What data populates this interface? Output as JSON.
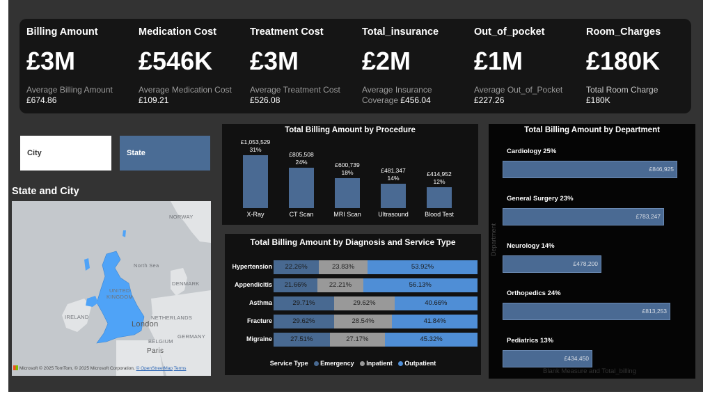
{
  "kpis": [
    {
      "title": "Billing Amount",
      "value": "£3M",
      "sub_label": "Average Billing Amount",
      "sub_label2": "",
      "sub_value": "£674.86"
    },
    {
      "title": "Medication Cost",
      "value": "£546K",
      "sub_label": "Average Medication Cost",
      "sub_label2": "",
      "sub_value": "£109.21"
    },
    {
      "title": "Treatment Cost",
      "value": "£3M",
      "sub_label": "Average Treatment Cost",
      "sub_label2": "",
      "sub_value": "£526.08"
    },
    {
      "title": "Total_insurance",
      "value": "£2M",
      "sub_label": "Average Insurance",
      "sub_label2": "Coverage",
      "sub_value": "£456.04"
    },
    {
      "title": "Out_of_pocket",
      "value": "£1M",
      "sub_label": "Average Out_of_Pocket",
      "sub_label2": "",
      "sub_value": "£227.26"
    },
    {
      "title": "Room_Charges",
      "value": "£180K",
      "sub_label": "Total Room Charge",
      "sub_label2": "",
      "sub_value": "£180K"
    }
  ],
  "slicers": {
    "city": "City",
    "state": "State"
  },
  "map": {
    "title": "State and City",
    "labels": {
      "norway": "NORWAY",
      "north_sea": "North Sea",
      "denmark": "DENMARK",
      "united": "UNITED",
      "kingdom": "KINGDOM",
      "ireland": "IRELAND",
      "netherlands": "NETHERLANDS",
      "london": "London",
      "germany": "GERMANY",
      "belgium": "BELGIUM",
      "paris": "Paris"
    },
    "attribution": {
      "brand": "Microsoft",
      "text": "© 2025 TomTom, © 2025 Microsoft Corporation,",
      "osm": "© OpenStreetMap",
      "terms": "Terms"
    },
    "colors": {
      "land": "#c4c8cc",
      "highlight": "#4fa3f7"
    }
  },
  "procedure_chart": {
    "title": "Total Billing Amount by Procedure",
    "chart_data": {
      "type": "bar",
      "categories": [
        "X-Ray",
        "CT Scan",
        "MRI Scan",
        "Ultrasound",
        "Blood Test"
      ],
      "values": [
        1053529,
        805508,
        600739,
        481347,
        414952
      ],
      "value_labels": [
        "£1,053,529",
        "£805,508",
        "£600,739",
        "£481,347",
        "£414,952"
      ],
      "pct_labels": [
        "31%",
        "24%",
        "18%",
        "14%",
        "12%"
      ],
      "ylim": [
        0,
        1053529
      ],
      "color": "#4a6a93"
    }
  },
  "diagnosis_chart": {
    "title": "Total Billing Amount by Diagnosis and Service Type",
    "chart_data": {
      "type": "bar",
      "stacked": "100%",
      "categories": [
        "Hypertension",
        "Appendicitis",
        "Asthma",
        "Fracture",
        "Migraine"
      ],
      "series": [
        {
          "name": "Emergency",
          "values": [
            22.26,
            21.66,
            29.71,
            29.62,
            27.51
          ],
          "labels": [
            "22.26%",
            "21.66%",
            "29.71%",
            "29.62%",
            "27.51%"
          ],
          "color": "#486991"
        },
        {
          "name": "Inpatient",
          "values": [
            23.83,
            22.21,
            29.62,
            28.54,
            27.17
          ],
          "labels": [
            "23.83%",
            "22.21%",
            "29.62%",
            "28.54%",
            "27.17%"
          ],
          "color": "#999999"
        },
        {
          "name": "Outpatient",
          "values": [
            53.92,
            56.13,
            40.66,
            41.84,
            45.32
          ],
          "labels": [
            "53.92%",
            "56.13%",
            "40.66%",
            "41.84%",
            "45.32%"
          ],
          "color": "#4f8ed6"
        }
      ],
      "legend_title": "Service Type",
      "legend": "bottom"
    }
  },
  "department_chart": {
    "title": "Total Billing Amount by Department",
    "axis_label": "Department",
    "footer": "Blank Measure and Total_billing",
    "chart_data": {
      "type": "bar",
      "orientation": "horizontal",
      "categories": [
        "Cardiology",
        "General Surgery",
        "Neurology",
        "Orthopedics",
        "Pediatrics"
      ],
      "pct_labels": [
        "25%",
        "23%",
        "14%",
        "24%",
        "13%"
      ],
      "values": [
        846925,
        783247,
        478200,
        813253,
        434450
      ],
      "value_labels": [
        "£846,925",
        "£783,247",
        "£478,200",
        "£813,253",
        "£434,450"
      ],
      "xlim": [
        0,
        846925
      ],
      "color": "#4a6a93"
    }
  }
}
